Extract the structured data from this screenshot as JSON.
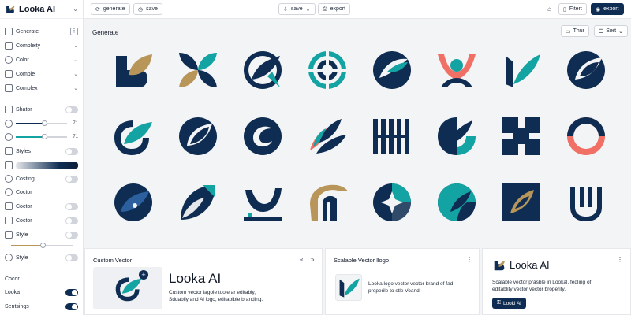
{
  "app": {
    "name": "Looka AI"
  },
  "sidebar": {
    "items": [
      {
        "label": "Generate"
      },
      {
        "label": "Compleity"
      },
      {
        "label": "Color"
      },
      {
        "label": "Comple"
      },
      {
        "label": "Complex"
      },
      {
        "label": "Shator"
      },
      {
        "label": "Styles"
      },
      {
        "label": "Costing"
      },
      {
        "label": "Coctor"
      },
      {
        "label": "Coctor"
      },
      {
        "label": "Coctor"
      },
      {
        "label": "Style"
      },
      {
        "label": "Style"
      },
      {
        "label": "Cocor"
      },
      {
        "label": "Looka"
      },
      {
        "label": "Sentsings"
      }
    ],
    "sliders": [
      {
        "value": "71",
        "level": 0.55,
        "color": "#0f2d52"
      },
      {
        "value": "71",
        "level": 0.55,
        "color": "#14a3a3"
      },
      {
        "level": 0.5,
        "color": "#b8965a"
      }
    ]
  },
  "toolbar": {
    "generate": "generate",
    "save": "save",
    "save_menu": "save",
    "export": "export",
    "filter": "Fitert",
    "export_primary": "export"
  },
  "gallery": {
    "title": "Generate",
    "thumb_btn": "Thur",
    "sort_btn": "Sert"
  },
  "panels": {
    "custom": {
      "title": "Custom Vector",
      "brand": "Looka AI",
      "desc_line1": "Custom vector lagole toole ar editably,",
      "desc_line2": "Sddabily and Al logo, editablbie branding."
    },
    "scalable": {
      "title": "Scalable Vector llogo",
      "desc_line1": "Looka logo vector vector brand of fad",
      "desc_line2": "properile to stle Voand."
    },
    "brand": {
      "name": "Looka AI",
      "desc_line1": "Scalable vector prasble in Lookal, fedling of",
      "desc_line2": "editablity vector vector broperity.",
      "cta": "Looki Al"
    }
  },
  "colors": {
    "navy": "#0f2d52",
    "teal": "#14a3a3",
    "gold": "#b8965a",
    "coral": "#f07065"
  }
}
